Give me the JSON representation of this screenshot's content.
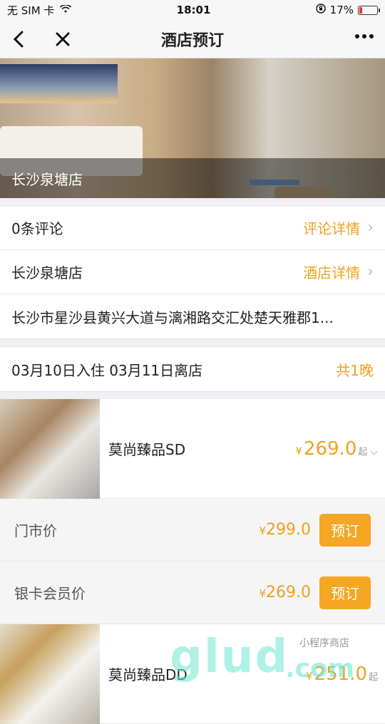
{
  "status_bar": {
    "carrier": "无 SIM 卡",
    "time": "18:01",
    "battery": "17%",
    "battery_level": 0.17,
    "battery_color": "#e53935"
  },
  "nav": {
    "title": "酒店预订",
    "back_icon": "chevron-left-icon",
    "close_icon": "close-icon",
    "more_icon": "more-icon"
  },
  "hotel": {
    "banner_caption": "长沙泉塘店",
    "reviews_label": "0条评论",
    "reviews_link": "评论详情",
    "name": "长沙泉塘店",
    "details_link": "酒店详情",
    "address": "长沙市星沙县黄兴大道与漓湘路交汇处楚天雅郡1..."
  },
  "stay": {
    "dates": "03月10日入住 03月11日离店",
    "nights": "共1晚"
  },
  "rooms": [
    {
      "name": "莫尚臻品SD",
      "price_symbol": "¥",
      "price": "269.0",
      "price_suffix": "起",
      "rates": [
        {
          "label": "门市价",
          "symbol": "¥",
          "amount": "299.0",
          "book": "预订"
        },
        {
          "label": "银卡会员价",
          "symbol": "¥",
          "amount": "269.0",
          "book": "预订"
        }
      ]
    },
    {
      "name": "莫尚臻品DD",
      "price_symbol": "¥",
      "price": "251.0",
      "price_suffix": "起"
    }
  ],
  "colors": {
    "accent": "#f0a020",
    "book_button": "#f5a623"
  },
  "watermark": {
    "brand": "glud",
    "tag": "小程序商店",
    "domain": ".com"
  }
}
